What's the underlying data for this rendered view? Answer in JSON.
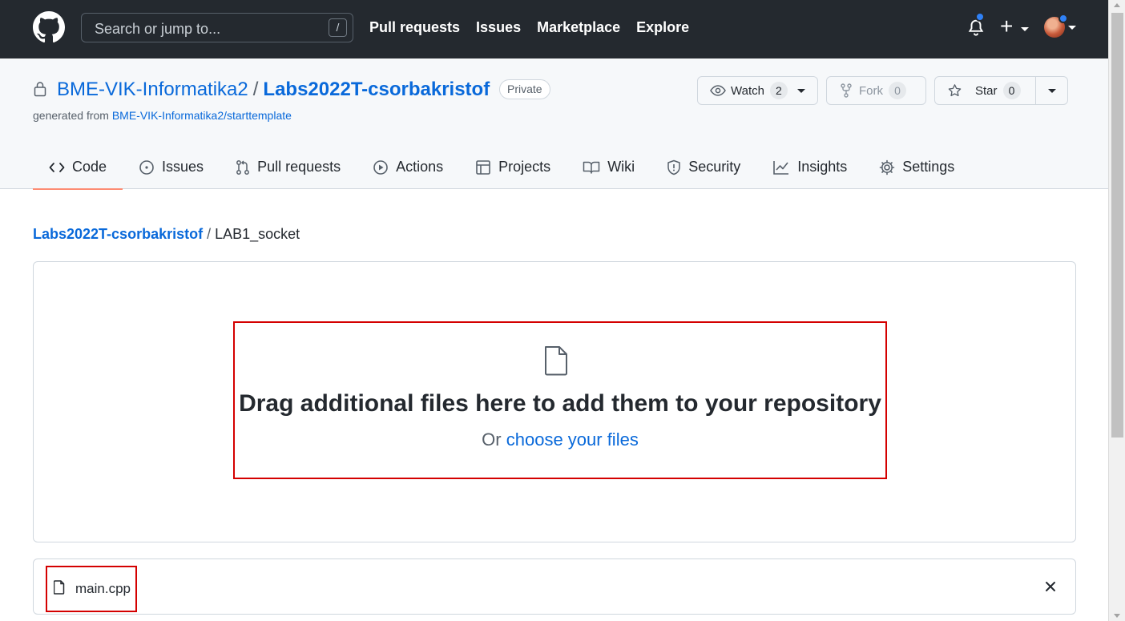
{
  "header": {
    "search_placeholder": "Search or jump to...",
    "search_shortcut": "/",
    "nav": [
      "Pull requests",
      "Issues",
      "Marketplace",
      "Explore"
    ],
    "plus_label": "+"
  },
  "repo": {
    "owner": "BME-VIK-Informatika2",
    "separator": "/",
    "name": "Labs2022T-csorbakristof",
    "visibility": "Private",
    "generated_prefix": "generated from",
    "template": "BME-VIK-Informatika2/starttemplate",
    "watch_label": "Watch",
    "watch_count": "2",
    "fork_label": "Fork",
    "fork_count": "0",
    "star_label": "Star",
    "star_count": "0"
  },
  "tabs": [
    {
      "label": "Code",
      "icon": "code-icon"
    },
    {
      "label": "Issues",
      "icon": "issue-icon"
    },
    {
      "label": "Pull requests",
      "icon": "pull-request-icon"
    },
    {
      "label": "Actions",
      "icon": "play-icon"
    },
    {
      "label": "Projects",
      "icon": "table-icon"
    },
    {
      "label": "Wiki",
      "icon": "book-icon"
    },
    {
      "label": "Security",
      "icon": "shield-icon"
    },
    {
      "label": "Insights",
      "icon": "graph-icon"
    },
    {
      "label": "Settings",
      "icon": "gear-icon"
    }
  ],
  "breadcrumb": {
    "repo": "Labs2022T-csorbakristof",
    "separator": "/",
    "folder": "LAB1_socket"
  },
  "upload": {
    "title": "Drag additional files here to add them to your repository",
    "or_text": "Or",
    "choose_link": "choose your files"
  },
  "files": [
    {
      "name": "main.cpp"
    }
  ],
  "colors": {
    "header_bg": "#24292f",
    "link": "#0969da",
    "highlight_border": "#d40000",
    "active_tab_underline": "#fd8c73",
    "notification_dot": "#2f81f7"
  }
}
